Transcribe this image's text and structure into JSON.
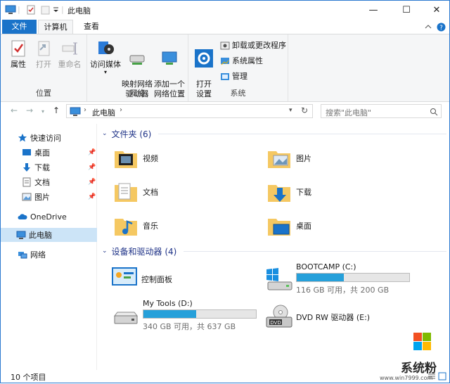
{
  "window": {
    "title": "此电脑"
  },
  "titlebar": {
    "icons": [
      "computer-icon",
      "properties-icon",
      "new-folder-icon",
      "dropdown-icon"
    ],
    "min": "—",
    "max": "☐",
    "close": "✕"
  },
  "tabs": [
    {
      "label": "文件",
      "active": false
    },
    {
      "label": "计算机",
      "active": true
    },
    {
      "label": "查看",
      "active": false
    }
  ],
  "ribbon": {
    "groups": [
      {
        "label": "位置",
        "buttons": [
          {
            "label": "属性",
            "icon": "properties-icon",
            "disabled": false
          },
          {
            "label": "打开",
            "icon": "open-icon",
            "disabled": true
          },
          {
            "label": "重命名",
            "icon": "rename-icon",
            "disabled": true
          }
        ]
      },
      {
        "label": "网络",
        "buttons": [
          {
            "label": "访问媒体",
            "icon": "media-icon",
            "disabled": false
          },
          {
            "label": "映射网络\n驱动器",
            "icon": "map-drive-icon",
            "disabled": false
          },
          {
            "label": "添加一个\n网络位置",
            "icon": "network-location-icon",
            "disabled": false
          }
        ]
      },
      {
        "label": "系统",
        "buttons": [
          {
            "label": "打开\n设置",
            "icon": "settings-icon",
            "disabled": false
          }
        ],
        "small": [
          {
            "label": "卸载或更改程序",
            "icon": "uninstall-icon"
          },
          {
            "label": "系统属性",
            "icon": "system-properties-icon"
          },
          {
            "label": "管理",
            "icon": "manage-icon"
          }
        ]
      }
    ]
  },
  "address": {
    "path": "此电脑",
    "search_placeholder": "搜索\"此电脑\""
  },
  "navpane": {
    "quick_access": "快速访问",
    "items": [
      {
        "label": "桌面",
        "icon": "desktop-icon",
        "pinned": true
      },
      {
        "label": "下载",
        "icon": "download-icon",
        "pinned": true
      },
      {
        "label": "文档",
        "icon": "document-icon",
        "pinned": true
      },
      {
        "label": "图片",
        "icon": "picture-icon",
        "pinned": true
      }
    ],
    "onedrive": "OneDrive",
    "this_pc": "此电脑",
    "network": "网络"
  },
  "folders_header": "文件夹 (6)",
  "folders": [
    {
      "label": "视频",
      "icon": "video-folder-icon"
    },
    {
      "label": "图片",
      "icon": "picture-folder-icon"
    },
    {
      "label": "文档",
      "icon": "document-folder-icon"
    },
    {
      "label": "下载",
      "icon": "download-folder-icon"
    },
    {
      "label": "音乐",
      "icon": "music-folder-icon"
    },
    {
      "label": "桌面",
      "icon": "desktop-folder-icon"
    }
  ],
  "drives_header": "设备和驱动器 (4)",
  "drives": [
    {
      "label": "控制面板",
      "icon": "control-panel-icon"
    },
    {
      "label": "BOOTCAMP (C:)",
      "icon": "windows-drive-icon",
      "free": "116 GB 可用，共 200 GB",
      "used_fraction": 0.42
    },
    {
      "label": "My Tools (D:)",
      "icon": "drive-icon",
      "free": "340 GB 可用，共 637 GB",
      "used_fraction": 0.47
    },
    {
      "label": "DVD RW 驱动器 (E:)",
      "icon": "dvd-drive-icon"
    }
  ],
  "status": {
    "count": "10 个项目"
  },
  "watermark": {
    "text": "系统粉",
    "url": "www.win7999.com"
  },
  "colors": {
    "accent": "#1a73c9",
    "selected": "#cce4f7",
    "bar_fill": "#26a0da",
    "section_text": "#1e3287"
  }
}
